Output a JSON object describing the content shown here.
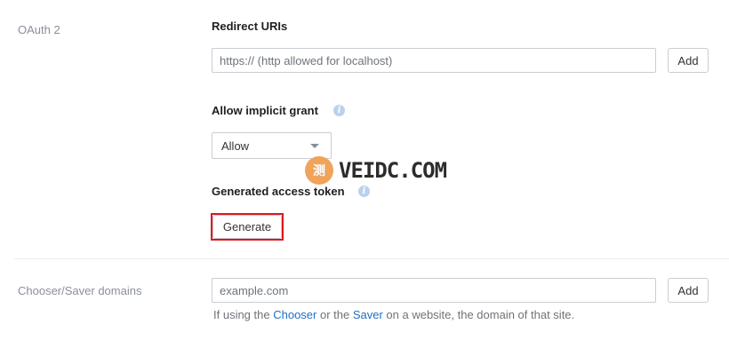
{
  "oauth": {
    "section_label": "OAuth 2",
    "redirect_title": "Redirect URIs",
    "redirect_placeholder": "https:// (http allowed for localhost)",
    "redirect_add_label": "Add",
    "implicit_title": "Allow implicit grant",
    "implicit_selected": "Allow",
    "token_title": "Generated access token",
    "generate_label": "Generate"
  },
  "chooser": {
    "section_label": "Chooser/Saver domains",
    "placeholder": "example.com",
    "add_label": "Add",
    "help_prefix": "If using the ",
    "help_chooser": "Chooser",
    "help_or": " or the ",
    "help_saver": "Saver",
    "help_suffix": " on a website, the domain of that site."
  },
  "watermark": {
    "badge": "测",
    "text": "VEIDC.COM"
  },
  "colors": {
    "highlight": "#e0161d",
    "link": "#1f6fc6",
    "info_icon": "#b9d1ec"
  },
  "icons": {
    "info": "info-icon",
    "dropdown": "chevron-down-icon"
  }
}
